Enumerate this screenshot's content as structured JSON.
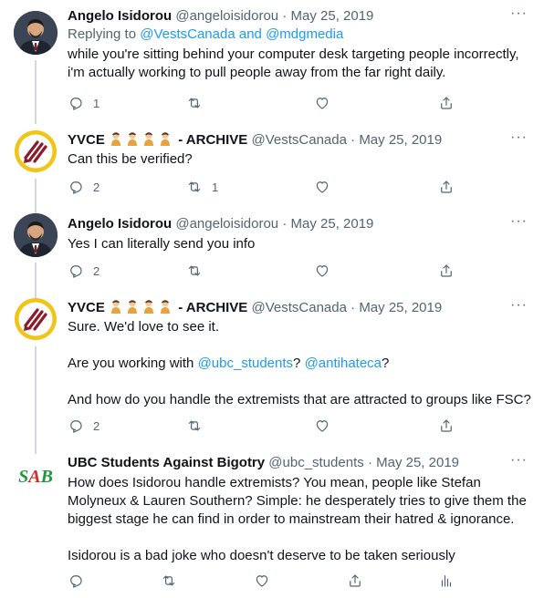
{
  "tweets": [
    {
      "name": "Angelo Isidorou",
      "handle": "@angeloisidorou",
      "dot": "·",
      "date": "May 25, 2019",
      "replying_prefix": "Replying to",
      "replying_user1": "@VestsCanada",
      "replying_and": "and",
      "replying_user2": "@mdgmedia",
      "text": "while you're sitting behind your computer desk targeting people incorrectly, i'm actually working to pull people away from the far right daily.",
      "replies": "1",
      "retweets": "",
      "likes": ""
    },
    {
      "name": "YVCE",
      "name_suffix": "- ARCHIVE",
      "handle": "@VestsCanada",
      "dot": "·",
      "date": "May 25, 2019",
      "text": "Can this be verified?",
      "replies": "2",
      "retweets": "1",
      "likes": ""
    },
    {
      "name": "Angelo Isidorou",
      "handle": "@angeloisidorou",
      "dot": "·",
      "date": "May 25, 2019",
      "text": "Yes I can literally send you info",
      "replies": "2",
      "retweets": "",
      "likes": ""
    },
    {
      "name": "YVCE",
      "name_suffix": "- ARCHIVE",
      "handle": "@VestsCanada",
      "dot": "·",
      "date": "May 25, 2019",
      "p1": "Sure. We'd love to see it.",
      "p2_prefix": "Are you working with",
      "p2_link1": "@ubc_students",
      "p2_mid": "?",
      "p2_link2": "@antihateca",
      "p2_suffix": "?",
      "p3": "And how do you handle the extremists that are attracted to groups like FSC?",
      "replies": "2",
      "retweets": "",
      "likes": ""
    },
    {
      "name": "UBC Students Against Bigotry",
      "handle": "@ubc_students",
      "dot": "·",
      "date": "May 25, 2019",
      "avatar_text": "SAB",
      "p1": "How does Isidorou handle extremists? You mean, people like Stefan Molyneux & Lauren Southern? Simple: he desperately tries to give them the biggest stage he can find in order to mainstream their hatred & ignorance.",
      "p2": "Isidorou is a bad joke who doesn't deserve to be taken seriously",
      "replies": "",
      "retweets": "",
      "likes": ""
    }
  ],
  "more_label": "···",
  "icons": [
    "reply-icon",
    "retweet-icon",
    "like-icon",
    "share-icon",
    "analytics-icon",
    "more-icon",
    "emoji-icon"
  ],
  "colors": {
    "link": "#1d9bf0",
    "muted": "#536471",
    "text": "#0f1419",
    "yvce_border": "#f0c419",
    "yvce_mark": "#8b1a2b",
    "sab_green": "#1e9a3a",
    "sab_red": "#d42a2a"
  }
}
